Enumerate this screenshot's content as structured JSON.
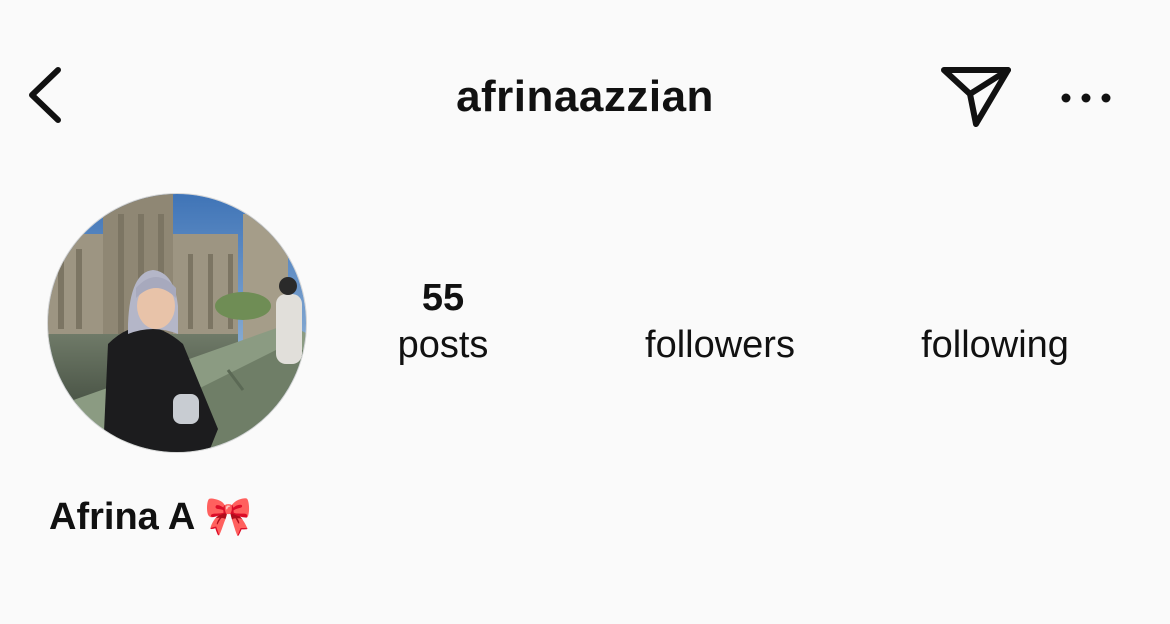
{
  "header": {
    "username": "afrinaazzian",
    "icons": {
      "back": "chevron-left-icon",
      "send": "paper-plane-icon",
      "more": "more-horizontal-icon"
    }
  },
  "profile": {
    "display_name": "Afrina A 🎀",
    "stats": [
      {
        "count": "55",
        "label": "posts"
      },
      {
        "count": "",
        "label": "followers"
      },
      {
        "count": "",
        "label": "following"
      }
    ]
  },
  "colors": {
    "background": "#fafafa",
    "text": "#111111"
  }
}
